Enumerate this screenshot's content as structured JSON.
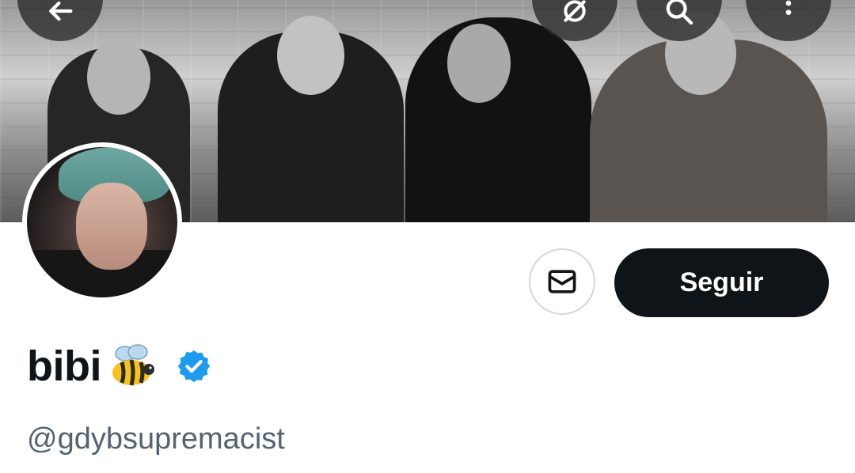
{
  "header": {
    "icons": {
      "back": "back-arrow-icon",
      "translate": "translate-icon",
      "search": "search-icon",
      "more": "more-vertical-icon"
    }
  },
  "profile": {
    "display_name": "bibi",
    "display_name_emoji": "bee-icon",
    "verified_badge": "verified-icon",
    "handle": "@gdybsupremacist"
  },
  "actions": {
    "message_icon": "mail-icon",
    "follow_label": "Seguir"
  },
  "colors": {
    "follow_bg": "#0f1419",
    "follow_text": "#ffffff",
    "verified_blue": "#1d9bf0",
    "handle_gray": "#536471",
    "name_text": "#0f1419"
  }
}
